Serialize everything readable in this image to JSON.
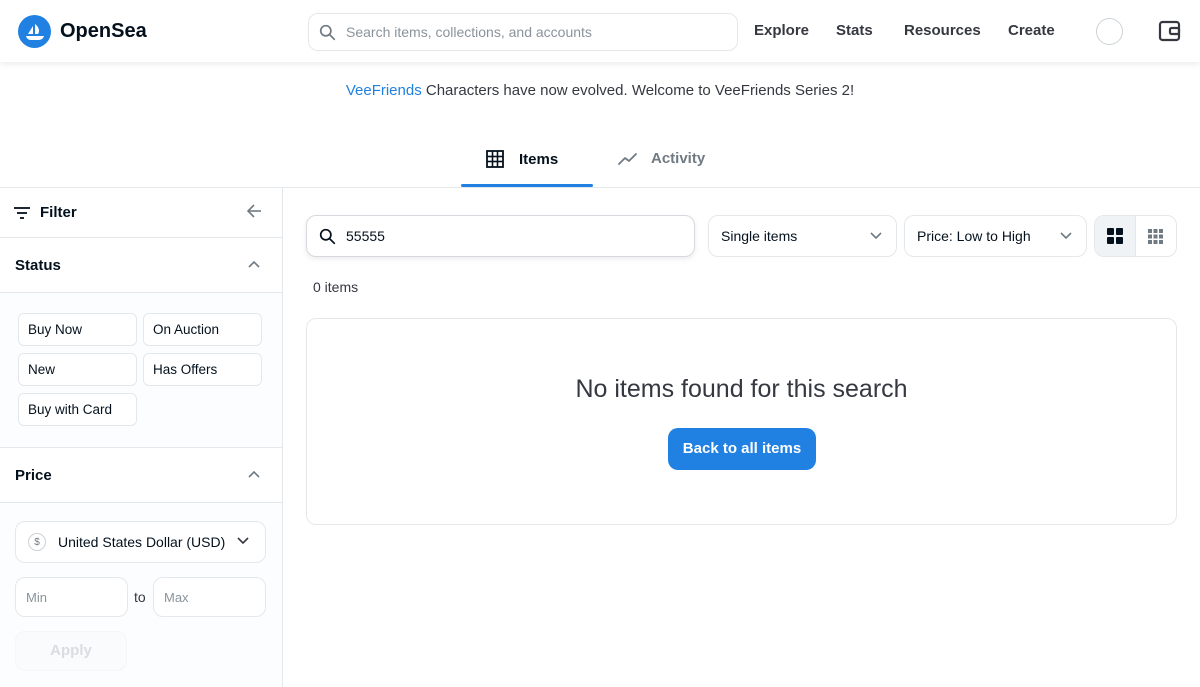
{
  "header": {
    "brand": "OpenSea",
    "search_placeholder": "Search items, collections, and accounts",
    "nav": [
      "Explore",
      "Stats",
      "Resources",
      "Create"
    ],
    "accent": "#2081e2"
  },
  "announcement": {
    "link_text": "VeeFriends",
    "text": " Characters have now evolved. Welcome to VeeFriends Series 2!"
  },
  "tabs": [
    {
      "label": "Items",
      "icon": "grid-icon",
      "active": true
    },
    {
      "label": "Activity",
      "icon": "activity-icon",
      "active": false
    }
  ],
  "sidebar": {
    "filter_label": "Filter",
    "status": {
      "title": "Status",
      "chips": [
        "Buy Now",
        "On Auction",
        "New",
        "Has Offers",
        "Buy with Card"
      ]
    },
    "price": {
      "title": "Price",
      "currency": "United States Dollar (USD)",
      "min_placeholder": "Min",
      "to_label": "to",
      "max_placeholder": "Max",
      "apply_label": "Apply"
    }
  },
  "main": {
    "search_value": "55555",
    "item_type": "Single items",
    "sort": "Price: Low to High",
    "item_count": "0 items",
    "empty_title": "No items found for this search",
    "back_button": "Back to all items"
  }
}
